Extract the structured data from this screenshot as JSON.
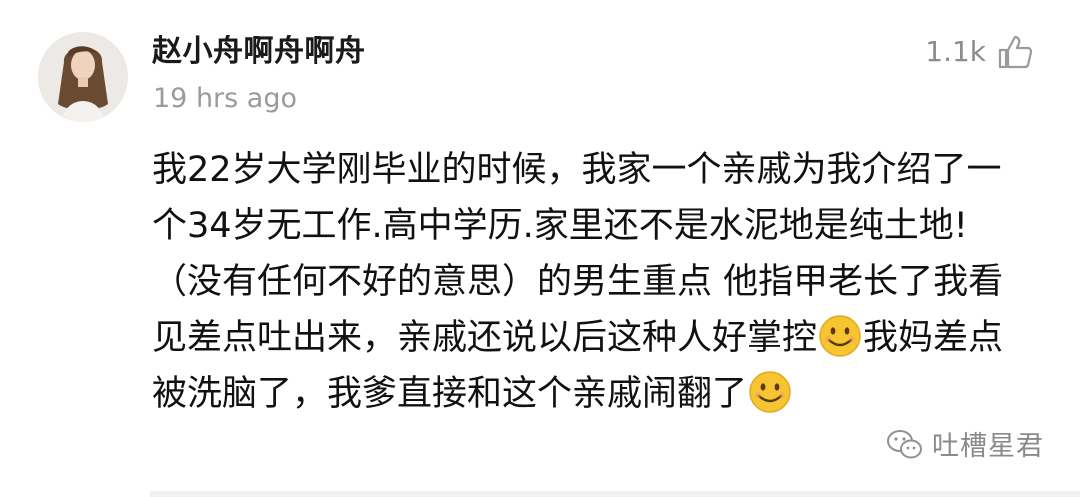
{
  "comment": {
    "username": "赵小舟啊舟啊舟",
    "timestamp": "19 hrs ago",
    "likes": "1.1k",
    "avatar_icon": "user-avatar-photo",
    "like_icon": "thumbs-up-icon",
    "text_part1": "我22岁大学刚毕业的时候，我家一个亲戚为我介绍了一个34岁无工作.高中学历.家里还不是水泥地是纯土地!（没有任何不好的意思）的男生重点 他指甲老长了我看见差点吐出来，亲戚还说以后这种人好掌控",
    "text_part2": "我妈差点被洗脑了，我爹直接和这个亲戚闹翻了",
    "emoji": "smiling-face-emoji"
  },
  "watermark": {
    "icon": "wechat-icon",
    "text": "吐槽星君"
  },
  "colors": {
    "text": "#111111",
    "muted": "#9b9b9b",
    "like": "#8c8c8c",
    "emoji_face": "#f7c531"
  }
}
